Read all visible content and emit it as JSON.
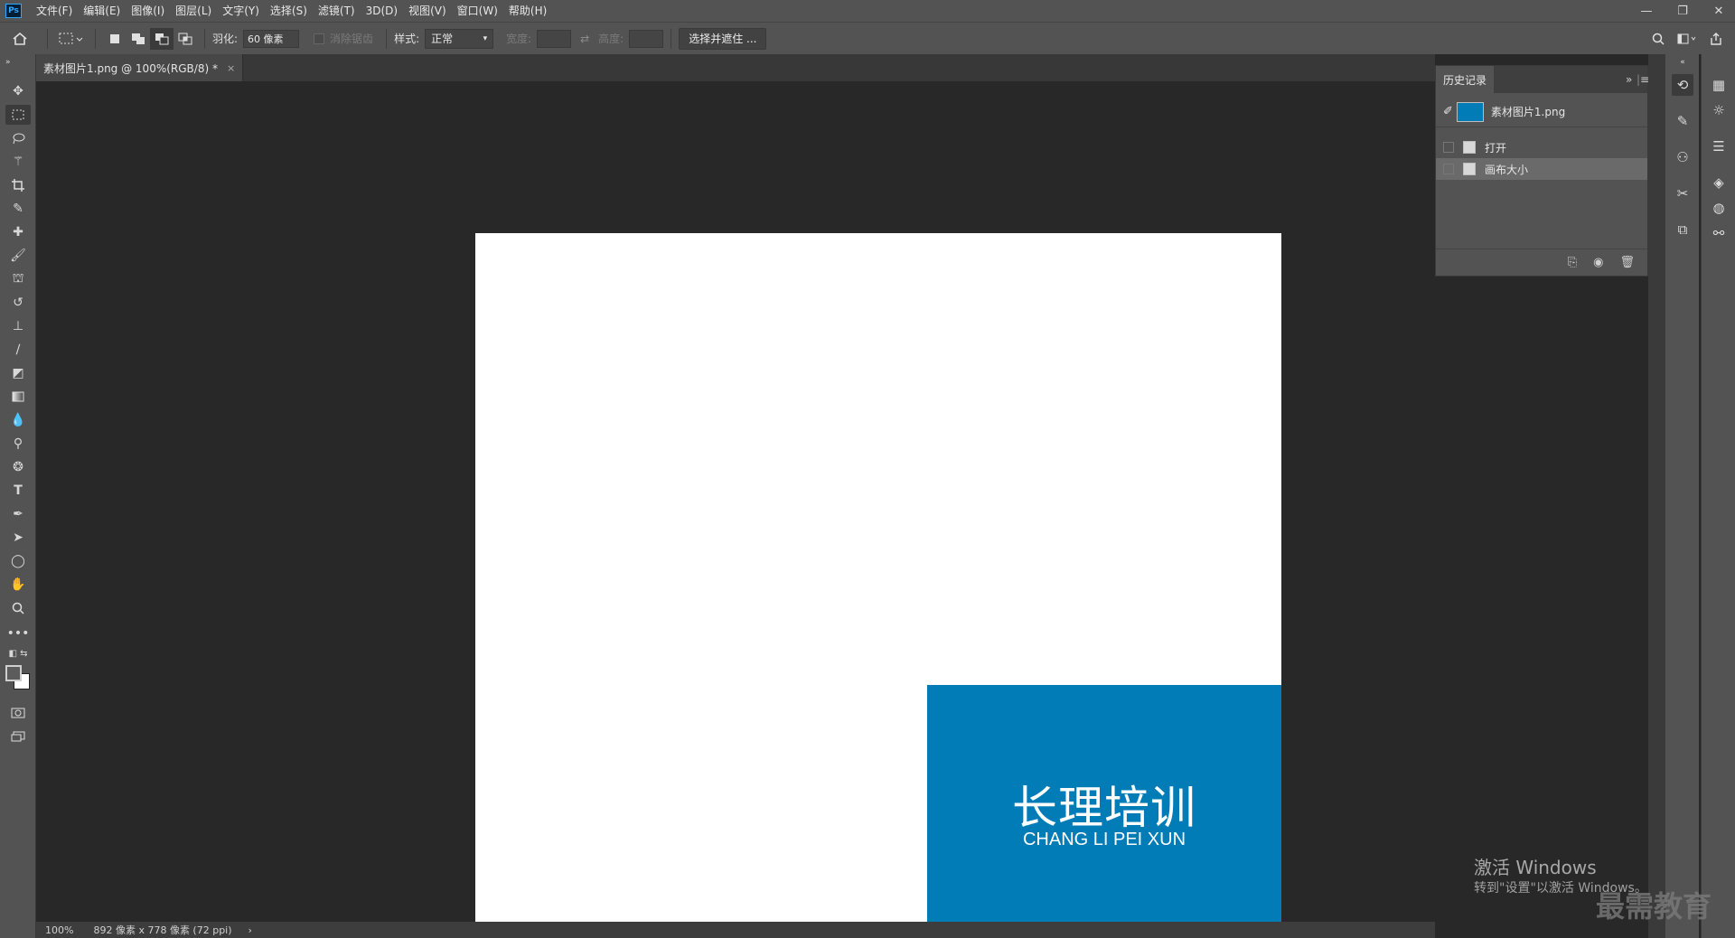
{
  "app": {
    "logo": "Ps"
  },
  "menu": [
    "文件(F)",
    "编辑(E)",
    "图像(I)",
    "图层(L)",
    "文字(Y)",
    "选择(S)",
    "滤镜(T)",
    "3D(D)",
    "视图(V)",
    "窗口(W)",
    "帮助(H)"
  ],
  "options": {
    "feather_label": "羽化:",
    "feather_value": "60 像素",
    "antialias_label": "消除锯齿",
    "style_label": "样式:",
    "style_value": "正常",
    "width_label": "宽度:",
    "height_label": "高度:",
    "select_mask_button": "选择并遮住 ..."
  },
  "document": {
    "tab_title": "素材图片1.png @ 100%(RGB/8) *",
    "close_glyph": "×"
  },
  "canvas": {
    "logo_cn": "长理培训",
    "logo_en": "CHANG LI PEI XUN",
    "block_color": "#027cb6"
  },
  "status": {
    "zoom": "100%",
    "doc_info": "892 像素 x 778 像素 (72 ppi)",
    "arrow": "›"
  },
  "history": {
    "tab_label": "历史记录",
    "snapshot_label": "素材图片1.png",
    "items": [
      {
        "label": "打开",
        "selected": false
      },
      {
        "label": "画布大小",
        "selected": true
      }
    ]
  },
  "watermark": {
    "title": "激活 Windows",
    "subtitle": "转到\"设置\"以激活 Windows。",
    "brand": "最需教育"
  }
}
